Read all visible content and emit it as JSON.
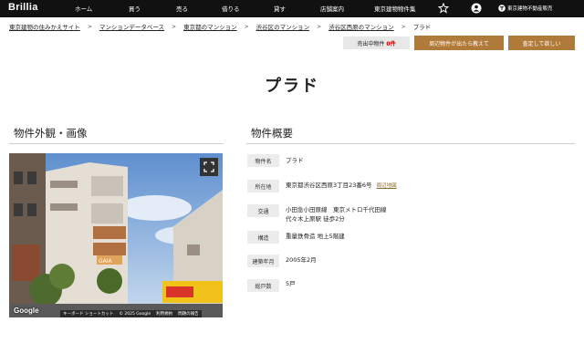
{
  "nav": {
    "logo": "Brillia",
    "items": [
      "ホーム",
      "買う",
      "売る",
      "借りる",
      "貸す",
      "店舗案内",
      "東京建物物件集"
    ],
    "corporate": "東京建物不動産販売",
    "icons": [
      "star-icon",
      "user-icon"
    ]
  },
  "breadcrumb": {
    "links": [
      "東京建物の住みかえサイト",
      "マンションデータベース",
      "東京都のマンション",
      "渋谷区のマンション",
      "渋谷区西原のマンション"
    ],
    "current": "プラド"
  },
  "actions": {
    "sold_label": "売出中物件",
    "sold_count": "0件",
    "notify_label": "周辺物件が出たら教えて",
    "assess_label": "査定して欲しい"
  },
  "title": "プラド",
  "sections": {
    "photos": "物件外観・画像",
    "overview": "物件概要"
  },
  "photo": {
    "google": "Google",
    "attribution": [
      "キーボード ショートカット",
      "© 2025 Google",
      "利用規約",
      "問題の報告"
    ]
  },
  "overview": [
    {
      "label": "物件名",
      "value": "プラド"
    },
    {
      "label": "所在地",
      "value": "東京都渋谷区西原3丁目23番6号",
      "link": "周辺地図"
    },
    {
      "label": "交通",
      "value": "小田急小田原線　東京メトロ千代田線",
      "value2": "代々木上原駅 徒歩2分"
    },
    {
      "label": "構造",
      "value": "重量鉄骨造 地上5階建"
    },
    {
      "label": "建築年月",
      "value": "2005年2月"
    },
    {
      "label": "総戸数",
      "value": "5戸"
    }
  ],
  "colors": {
    "nav_bg": "#111111",
    "accent": "#b07a3a",
    "sold_count": "#cc0000"
  }
}
